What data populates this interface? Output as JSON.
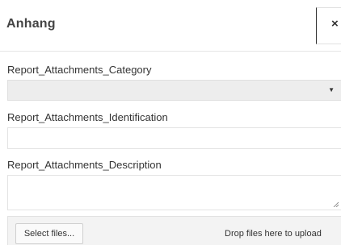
{
  "dialog": {
    "title": "Anhang",
    "close_glyph": "×",
    "close_icon": "close-icon"
  },
  "form": {
    "category_label": "Report_Attachments_Category",
    "category_value": "",
    "category_arrow_icon": "caret-down-icon",
    "identification_label": "Report_Attachments_Identification",
    "identification_value": "",
    "description_label": "Report_Attachments_Description",
    "description_value": "",
    "resize_icon": "resize-grip-icon"
  },
  "upload": {
    "select_files_label": "Select files...",
    "drop_hint": "Drop files here to upload"
  },
  "colors": {
    "select_background": "#ededed",
    "upload_background": "#f3f3f3",
    "border": "#e0e0e0",
    "text": "#333333"
  }
}
